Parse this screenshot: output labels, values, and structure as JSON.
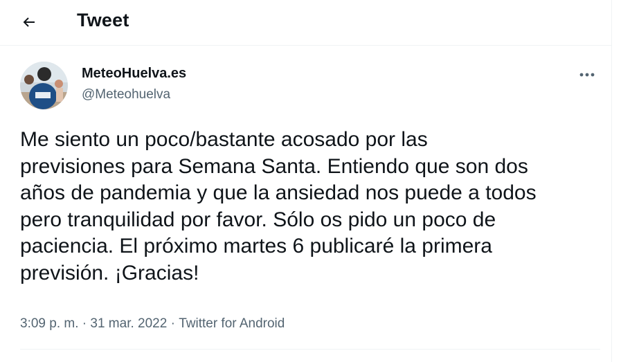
{
  "header": {
    "back_icon": "arrow-left-icon",
    "title": "Tweet"
  },
  "author": {
    "display_name": "MeteoHuelva.es",
    "handle": "@Meteohuelva"
  },
  "tweet": {
    "text": "Me siento un poco/bastante acosado por las\nprevisiones para Semana Santa. Entiendo que son dos\naños de pandemia y que la ansiedad nos puede a todos\npero tranquilidad por favor. Sólo os pido un poco de\npaciencia. El próximo martes 6 publicaré la primera\nprevisión. ¡Gracias!",
    "time": "3:09 p. m.",
    "separator": "·",
    "date": "31 mar. 2022",
    "source": "Twitter for Android"
  },
  "more_icon": "more-horizontal-icon",
  "colors": {
    "text_primary": "#0f1419",
    "text_secondary": "#536471",
    "divider": "#eff3f4",
    "background": "#ffffff"
  }
}
